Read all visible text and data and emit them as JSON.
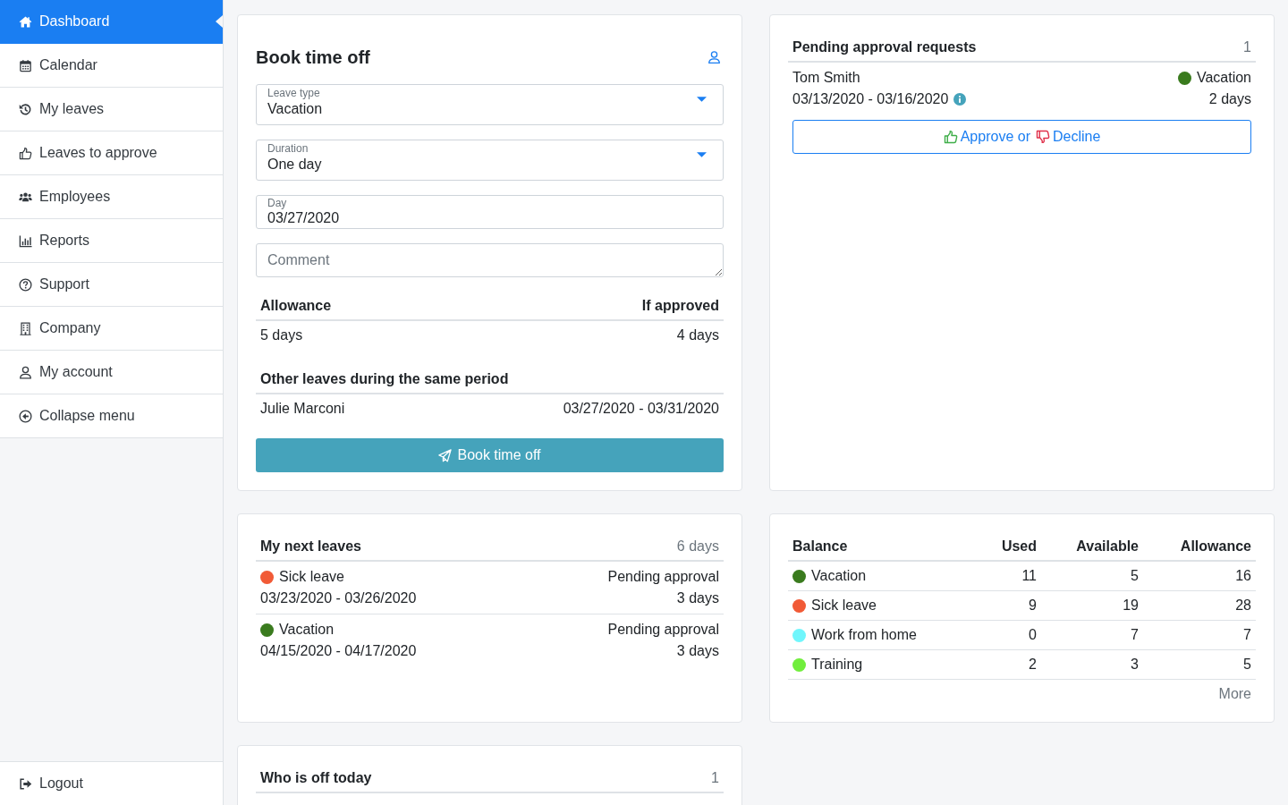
{
  "sidebar": {
    "items": [
      {
        "label": "Dashboard",
        "selected": true
      },
      {
        "label": "Calendar",
        "selected": false
      },
      {
        "label": "My leaves",
        "selected": false
      },
      {
        "label": "Leaves to approve",
        "selected": false
      },
      {
        "label": "Employees",
        "selected": false
      },
      {
        "label": "Reports",
        "selected": false
      },
      {
        "label": "Support",
        "selected": false
      },
      {
        "label": "Company",
        "selected": false
      },
      {
        "label": "My account",
        "selected": false
      },
      {
        "label": "Collapse menu",
        "selected": false
      }
    ],
    "logout": "Logout"
  },
  "book_time_off": {
    "title": "Book time off",
    "fields": [
      {
        "kind": "select",
        "label": "Leave type",
        "value": "Vacation"
      },
      {
        "kind": "select",
        "label": "Duration",
        "value": "One day"
      },
      {
        "kind": "date",
        "label": "Day",
        "value": "03/27/2020"
      },
      {
        "kind": "textarea",
        "placeholder": "Comment"
      }
    ],
    "allowance": {
      "columns": [
        "Allowance",
        "If approved"
      ],
      "rows": [
        [
          "5 days",
          "4 days"
        ]
      ]
    },
    "other_leaves": {
      "title": "Other leaves during the same period",
      "rows": [
        {
          "name": "Julie Marconi",
          "period": "03/27/2020 - 03/31/2020"
        }
      ]
    },
    "submit": "Book time off"
  },
  "pending_requests": {
    "title": "Pending approval requests",
    "count": "1",
    "rows": [
      {
        "name": "Tom Smith",
        "period": "03/13/2020 - 03/16/2020",
        "type": "Vacation",
        "color": "#3a7b1e",
        "duration": "2 days"
      }
    ],
    "action": {
      "approve": "Approve or",
      "decline": "Decline"
    }
  },
  "next_leaves": {
    "title": "My next leaves",
    "total": "6 days",
    "rows": [
      {
        "type": "Sick leave",
        "color": "#f15a36",
        "period": "03/23/2020 - 03/26/2020",
        "status": "Pending approval",
        "duration": "3 days"
      },
      {
        "type": "Vacation",
        "color": "#3a7b1e",
        "period": "04/15/2020 - 04/17/2020",
        "status": "Pending approval",
        "duration": "3 days"
      }
    ]
  },
  "balance": {
    "columns": [
      "Balance",
      "Used",
      "Available",
      "Allowance"
    ],
    "rows": [
      {
        "type": "Vacation",
        "color": "#3a7b1e",
        "used": "11",
        "available": "5",
        "allowance": "16"
      },
      {
        "type": "Sick leave",
        "color": "#f15a36",
        "used": "9",
        "available": "19",
        "allowance": "28"
      },
      {
        "type": "Work from home",
        "color": "#70f6fc",
        "used": "0",
        "available": "7",
        "allowance": "7"
      },
      {
        "type": "Training",
        "color": "#71ee3d",
        "used": "2",
        "available": "3",
        "allowance": "5"
      }
    ],
    "more": "More"
  },
  "off_today": {
    "title": "Who is off today",
    "count": "1"
  }
}
